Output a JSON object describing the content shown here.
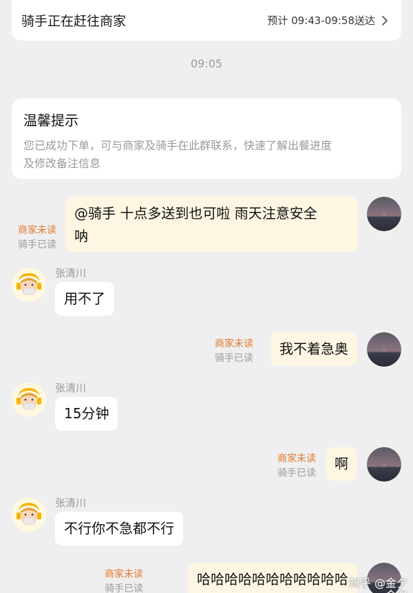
{
  "status": {
    "text": "骑手正在赶往商家",
    "eta": "预计 09:43-09:58送达"
  },
  "timestamp": "09:05",
  "tip": {
    "title": "温馨提示",
    "body_line1": "您已成功下单，可与商家及骑手在此群联系，快速了解出餐进度",
    "body_line2": "及修改备注信息"
  },
  "messages": [
    {
      "from": "me",
      "line1": "@骑手 十点多送到也可啦 雨天注意安全",
      "line2": "呐",
      "unread": "商家未读",
      "read": "骑手已读"
    },
    {
      "from": "rider",
      "name": "张清川",
      "text": "用不了"
    },
    {
      "from": "me",
      "text": "我不着急奥",
      "unread": "商家未读",
      "read": "骑手已读"
    },
    {
      "from": "rider",
      "name": "张清川",
      "text": "15分钟"
    },
    {
      "from": "me",
      "text": "啊",
      "unread": "商家未读",
      "read": "骑手已读"
    },
    {
      "from": "rider",
      "name": "张清川",
      "text": "不行你不急都不行"
    },
    {
      "from": "me",
      "text": "哈哈哈哈哈哈哈哈哈哈哈",
      "unread": "商家未读",
      "read": "骑手已读"
    }
  ],
  "watermark": {
    "line1": "知乎 @金夕",
    "line2": "金夕"
  }
}
